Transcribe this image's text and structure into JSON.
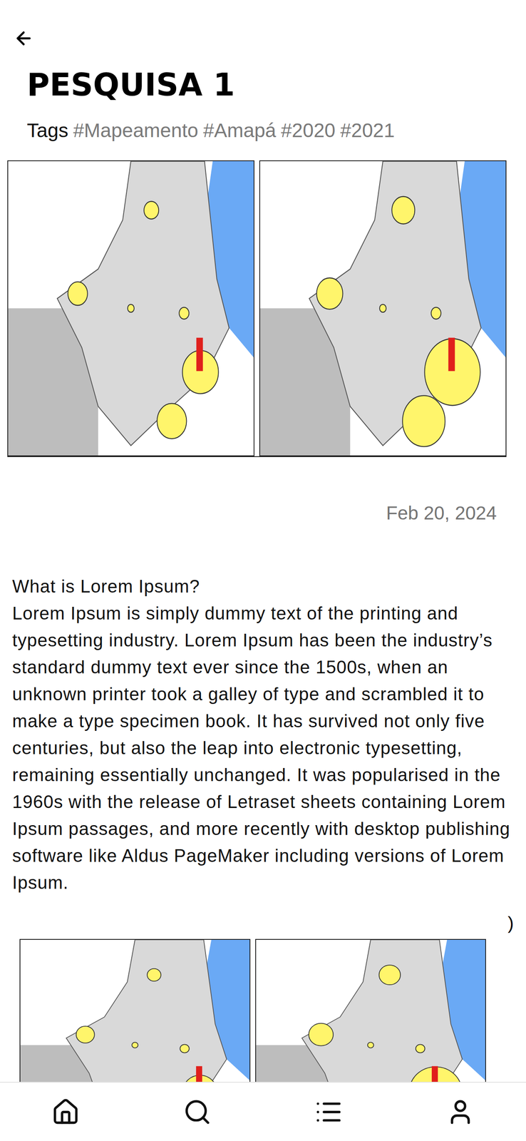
{
  "post": {
    "title": "PESQUISA 1",
    "tags_label": "Tags",
    "tags": [
      "#Mapeamento",
      "#Amapá",
      "#2020",
      "#2021"
    ],
    "date": "Feb 20, 2024",
    "heading": "What is Lorem Ipsum?",
    "body": "Lorem Ipsum is simply dummy text of the printing and typesetting industry. Lorem Ipsum has been the industry’s standard dummy text ever since the 1500s, when an unknown printer took a galley of type and scrambled it to make a type specimen book. It has survived not only five centuries, but also the leap into electronic typesetting, remaining essentially unchanged. It was popularised in the 1960s with the release of Letraset sheets containing Lorem Ipsum passages, and more recently with desktop publishing software like Aldus PageMaker including versions of Lorem Ipsum.",
    "trailing_mark": ")"
  },
  "bottom_nav": [
    {
      "icon": "home"
    },
    {
      "icon": "search"
    },
    {
      "icon": "list"
    },
    {
      "icon": "user"
    }
  ]
}
